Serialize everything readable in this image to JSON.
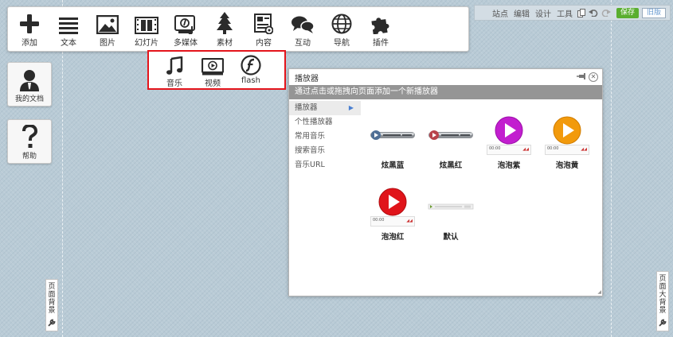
{
  "toolbar": {
    "items": [
      {
        "label": "添加",
        "icon": "plus-icon"
      },
      {
        "label": "文本",
        "icon": "text-lines-icon"
      },
      {
        "label": "图片",
        "icon": "image-icon"
      },
      {
        "label": "幻灯片",
        "icon": "filmstrip-icon"
      },
      {
        "label": "多媒体",
        "icon": "multimedia-icon"
      },
      {
        "label": "素材",
        "icon": "tree-icon"
      },
      {
        "label": "内容",
        "icon": "content-icon"
      },
      {
        "label": "互动",
        "icon": "chat-bubbles-icon"
      },
      {
        "label": "导航",
        "icon": "globe-icon"
      },
      {
        "label": "插件",
        "icon": "puzzle-icon"
      }
    ]
  },
  "submenu": {
    "items": [
      {
        "label": "音乐",
        "icon": "music-note-icon"
      },
      {
        "label": "视频",
        "icon": "video-play-icon"
      },
      {
        "label": "flash",
        "icon": "flash-icon"
      }
    ],
    "highlight_color": "#e4141b"
  },
  "sidebar": {
    "my_docs": "我的文档",
    "help": "帮助"
  },
  "topbar": {
    "site": "站点",
    "edit": "编辑",
    "design": "设计",
    "tools": "工具",
    "save": "保存",
    "old": "旧版"
  },
  "page_bg": {
    "label": [
      "页",
      "面",
      "背",
      "景"
    ]
  },
  "page_big_bg": {
    "label": [
      "页",
      "面",
      "大",
      "背",
      "景"
    ]
  },
  "panel": {
    "title": "播放器",
    "hint": "通过点击或拖拽向页面添加一个新播放器",
    "categories": [
      {
        "label": "播放器",
        "active": true
      },
      {
        "label": "个性播放器"
      },
      {
        "label": "常用音乐"
      },
      {
        "label": "搜索音乐"
      },
      {
        "label": "音乐URL"
      }
    ],
    "skins": [
      {
        "name": "炫黑蓝",
        "style": "dark-blue"
      },
      {
        "name": "炫黑红",
        "style": "dark-red"
      },
      {
        "name": "泡泡紫",
        "style": "bubble",
        "color": "#c21ecf"
      },
      {
        "name": "泡泡黄",
        "style": "bubble",
        "color": "#f29a0c"
      },
      {
        "name": "泡泡红",
        "style": "bubble",
        "color": "#e0141a"
      },
      {
        "name": "默认",
        "style": "default"
      }
    ],
    "mini_time": "00:00"
  },
  "colors": {
    "accent_save": "#5aae2f",
    "hint_bar": "#959595"
  }
}
